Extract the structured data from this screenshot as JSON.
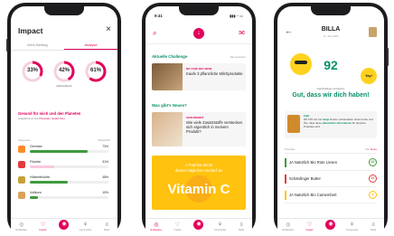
{
  "colors": {
    "brand": "#e2005a",
    "green": "#0a8f6a",
    "yellow": "#ffc20e"
  },
  "phone1": {
    "title": "Impact",
    "close_icon": "close-icon",
    "tabs": [
      "Mein Beitrag",
      "Analyse"
    ],
    "rings": [
      {
        "pct": "33%",
        "label": "",
        "value": 0.33
      },
      {
        "pct": "42%",
        "label": "Nährstoffreich",
        "value": 0.42
      },
      {
        "pct": "61%",
        "label": "",
        "value": 0.61
      }
    ],
    "goal_title": "Gesund für mich und den Planeten",
    "goal_sub_prefix": "Angelehnt an die",
    "goal_sub_link": "Planetary Health Diet",
    "table_head_left": "Kategorien",
    "table_head_right": "Tatsächlich",
    "foods": [
      {
        "name": "Gemüse",
        "pct": "73%",
        "value": 0.73,
        "color": "#3f9a3a",
        "icon": "#ff8a2a"
      },
      {
        "name": "Früchte",
        "pct": "31%",
        "value": 0.31,
        "color": "#f8c9dc",
        "icon": "#e33b3b"
      },
      {
        "name": "Hülsenfrüchte",
        "pct": "48%",
        "value": 0.48,
        "color": "#3f9a3a",
        "icon": "#c6a03b"
      },
      {
        "name": "Vollkorn",
        "pct": "10%",
        "value": 0.1,
        "color": "#3f9a3a",
        "icon": "#d9a35a"
      }
    ],
    "tabbar": [
      "Entdecken",
      "Impact",
      "",
      "Community",
      "Mehr"
    ]
  },
  "phone2": {
    "time": "9:41",
    "status": "▮▮▮ ◔ ▭",
    "icons": {
      "left": "search-icon",
      "right": "chat-icon"
    },
    "section1": "Aktuelle Challenge",
    "section1_more": "Alle ansehen",
    "card1_tag": "NO COW, BIG WOW",
    "card1_text": "Kaufe 3 pflanzliche Milchprodukte",
    "section2": "Was gibt's Neues?",
    "card2_tag": "GESUNDHEIT",
    "card2_text": "Wie viele Zusatzstoffe verstecken sich eigentlich in meinem Produkt?",
    "banner_line1": "1 Paprika deckt",
    "banner_line2": "deinen täglichen Bedarf an",
    "banner_big": "Vitamin C",
    "tabbar": [
      "Entdecken",
      "Impact",
      "",
      "Community",
      "Mehr"
    ]
  },
  "phone3": {
    "store": "BILLA",
    "date": "12. Juni 2023",
    "score": "92",
    "yay": "Yay!",
    "small": "Nachhaltiger einkaufen",
    "message": "Gut, dass wir dich haben!",
    "fact_title": "Fakt",
    "fact_text_1": "Mit 70% der bei ",
    "fact_text_hl1": "Imaje",
    "fact_text_2": " Nutzer verhandelten hinein Fette und Öle, dass diese ",
    "fact_text_hl2": "pflanzliche Alternativen",
    "fact_text_3": " für tierische Produkte sind.",
    "table_left": "Produkte",
    "table_right_a": "Abc",
    "table_right_b": "Score",
    "items": [
      {
        "name": "JA Natürlich Bio Rote Linsen",
        "score": "22",
        "color": "#3f9a3a"
      },
      {
        "name": "Schärdinger Butter",
        "score": "11",
        "color": "#e33b3b"
      },
      {
        "name": "JA Natürlich Bio Camembert",
        "score": "8",
        "color": "#ffc20e"
      }
    ],
    "tabbar": [
      "Entdecken",
      "Impact",
      "",
      "Community",
      "Mehr"
    ]
  }
}
